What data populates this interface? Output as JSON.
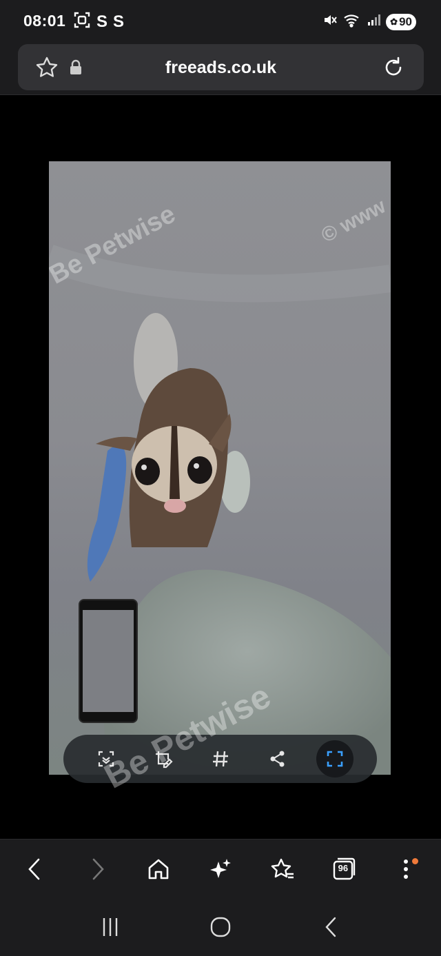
{
  "status_bar": {
    "time": "08:01",
    "left_glyphs": [
      "S",
      "S"
    ],
    "battery": "90"
  },
  "browser": {
    "url": "freeads.co.uk"
  },
  "content": {
    "watermarks": [
      "Be Petwise",
      "© www",
      "Be Petwise"
    ],
    "toolbar_tools": [
      "scan-text-icon",
      "edit-crop-icon",
      "hashtag-icon",
      "share-icon",
      "screen-capture-icon"
    ]
  },
  "bottom_nav": {
    "tabs_count": "96"
  },
  "colors": {
    "bar_bg": "#1c1c1e",
    "url_bg": "#323235",
    "accent_dot": "#f07a3a",
    "capture_accent": "#3aa0ff"
  }
}
